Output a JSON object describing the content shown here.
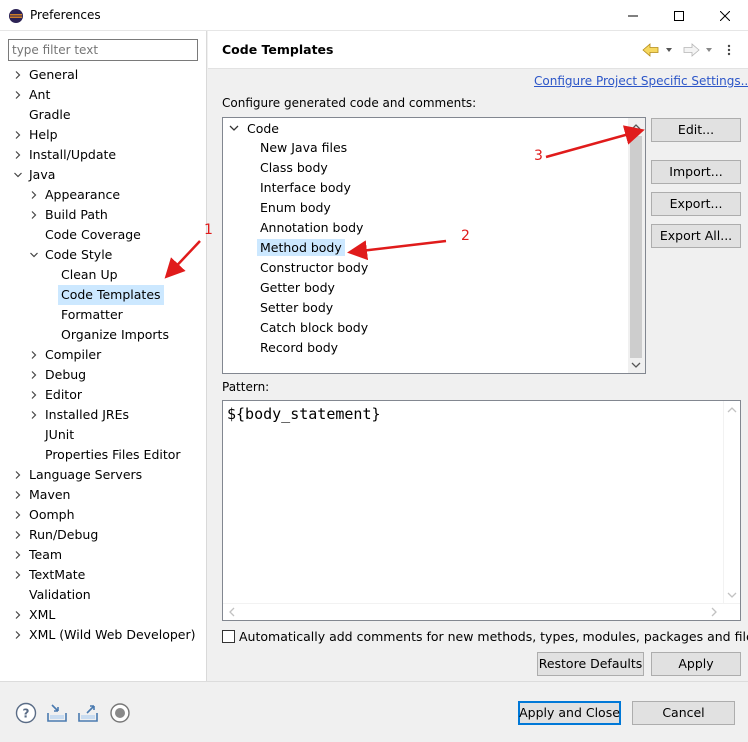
{
  "window": {
    "title": "Preferences"
  },
  "filter": {
    "placeholder": "type filter text"
  },
  "tree": [
    {
      "label": "General",
      "expander": "collapsed",
      "selected": false
    },
    {
      "label": "Ant",
      "expander": "collapsed",
      "selected": false
    },
    {
      "label": "Gradle",
      "expander": "none",
      "selected": false
    },
    {
      "label": "Help",
      "expander": "collapsed",
      "selected": false
    },
    {
      "label": "Install/Update",
      "expander": "collapsed",
      "selected": false
    },
    {
      "label": "Java",
      "expander": "expanded",
      "selected": false
    },
    {
      "label": "Appearance",
      "expander": "collapsed",
      "selected": false
    },
    {
      "label": "Build Path",
      "expander": "collapsed",
      "selected": false
    },
    {
      "label": "Code Coverage",
      "expander": "none",
      "selected": false
    },
    {
      "label": "Code Style",
      "expander": "expanded",
      "selected": false
    },
    {
      "label": "Clean Up",
      "expander": "none",
      "selected": false
    },
    {
      "label": "Code Templates",
      "expander": "none",
      "selected": true
    },
    {
      "label": "Formatter",
      "expander": "none",
      "selected": false
    },
    {
      "label": "Organize Imports",
      "expander": "none",
      "selected": false
    },
    {
      "label": "Compiler",
      "expander": "collapsed",
      "selected": false
    },
    {
      "label": "Debug",
      "expander": "collapsed",
      "selected": false
    },
    {
      "label": "Editor",
      "expander": "collapsed",
      "selected": false
    },
    {
      "label": "Installed JREs",
      "expander": "collapsed",
      "selected": false
    },
    {
      "label": "JUnit",
      "expander": "none",
      "selected": false
    },
    {
      "label": "Properties Files Editor",
      "expander": "none",
      "selected": false
    },
    {
      "label": "Language Servers",
      "expander": "collapsed",
      "selected": false
    },
    {
      "label": "Maven",
      "expander": "collapsed",
      "selected": false
    },
    {
      "label": "Oomph",
      "expander": "collapsed",
      "selected": false
    },
    {
      "label": "Run/Debug",
      "expander": "collapsed",
      "selected": false
    },
    {
      "label": "Team",
      "expander": "collapsed",
      "selected": false
    },
    {
      "label": "TextMate",
      "expander": "collapsed",
      "selected": false
    },
    {
      "label": "Validation",
      "expander": "none",
      "selected": false
    },
    {
      "label": "XML",
      "expander": "collapsed",
      "selected": false
    },
    {
      "label": "XML (Wild Web Developer)",
      "expander": "collapsed",
      "selected": false
    }
  ],
  "page": {
    "title": "Code Templates",
    "config_link": "Configure Project Specific Settings...",
    "section_label": "Configure generated code and comments:",
    "pattern_label": "Pattern:",
    "pattern_text": "${body_statement}",
    "auto_comments_label": "Automatically add comments for new methods, types, modules, packages and files",
    "auto_comments_checked": false
  },
  "templates": {
    "root": "Code",
    "items": [
      {
        "label": "New Java files",
        "selected": false
      },
      {
        "label": "Class body",
        "selected": false
      },
      {
        "label": "Interface body",
        "selected": false
      },
      {
        "label": "Enum body",
        "selected": false
      },
      {
        "label": "Annotation body",
        "selected": false
      },
      {
        "label": "Method body",
        "selected": true
      },
      {
        "label": "Constructor body",
        "selected": false
      },
      {
        "label": "Getter body",
        "selected": false
      },
      {
        "label": "Setter body",
        "selected": false
      },
      {
        "label": "Catch block body",
        "selected": false
      },
      {
        "label": "Record body",
        "selected": false
      }
    ]
  },
  "side_buttons": {
    "edit": "Edit...",
    "import": "Import...",
    "export": "Export...",
    "export_all": "Export All..."
  },
  "page_buttons": {
    "restore": "Restore Defaults",
    "apply": "Apply"
  },
  "dialog_buttons": {
    "apply_close": "Apply and Close",
    "cancel": "Cancel"
  },
  "annotations": {
    "one": "1",
    "two": "2",
    "three": "3"
  },
  "bottom_icons": [
    "help-icon",
    "import-icon",
    "export-icon",
    "record-icon"
  ],
  "colors": {
    "selection": "#cce8ff",
    "link": "#2c56c8",
    "annotation": "#e01b1b",
    "default_button_border": "#0078d7"
  }
}
